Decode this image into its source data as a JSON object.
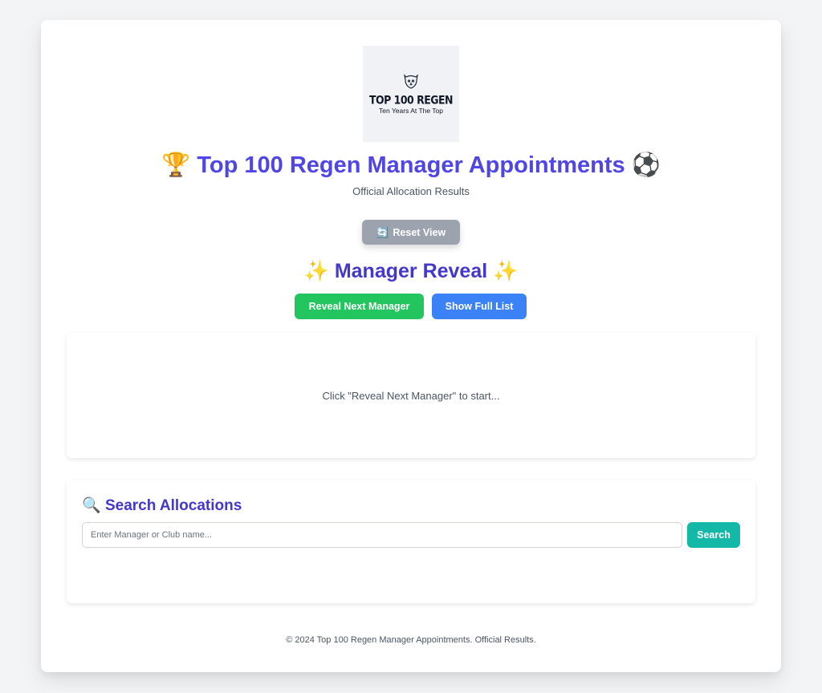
{
  "logo": {
    "title": "TOP 100 REGEN",
    "tagline": "Ten Years At The Top",
    "icon": "dog-head-icon"
  },
  "header": {
    "title_prefix_icon": "🏆",
    "title": "Top 100 Regen Manager Appointments",
    "title_suffix_icon": "⚽",
    "subtitle": "Official Allocation Results"
  },
  "controls": {
    "reset_icon": "🔄",
    "reset_label": "Reset View"
  },
  "reveal": {
    "title_icon": "✨",
    "title": "Manager Reveal",
    "reveal_next_label": "Reveal Next Manager",
    "show_full_list_label": "Show Full List",
    "placeholder_message": "Click \"Reveal Next Manager\" to start..."
  },
  "search": {
    "title_icon": "🔍",
    "title": "Search Allocations",
    "input_placeholder": "Enter Manager or Club name...",
    "input_value": "",
    "button_label": "Search"
  },
  "footer": {
    "text": "© 2024 Top 100 Regen Manager Appointments. Official Results."
  },
  "colors": {
    "title": "#4f46e5",
    "section_title": "#4338ca",
    "reset": "#9ca3af",
    "reveal_next": "#22c55e",
    "show_list": "#3b82f6",
    "search": "#14b8a6"
  }
}
